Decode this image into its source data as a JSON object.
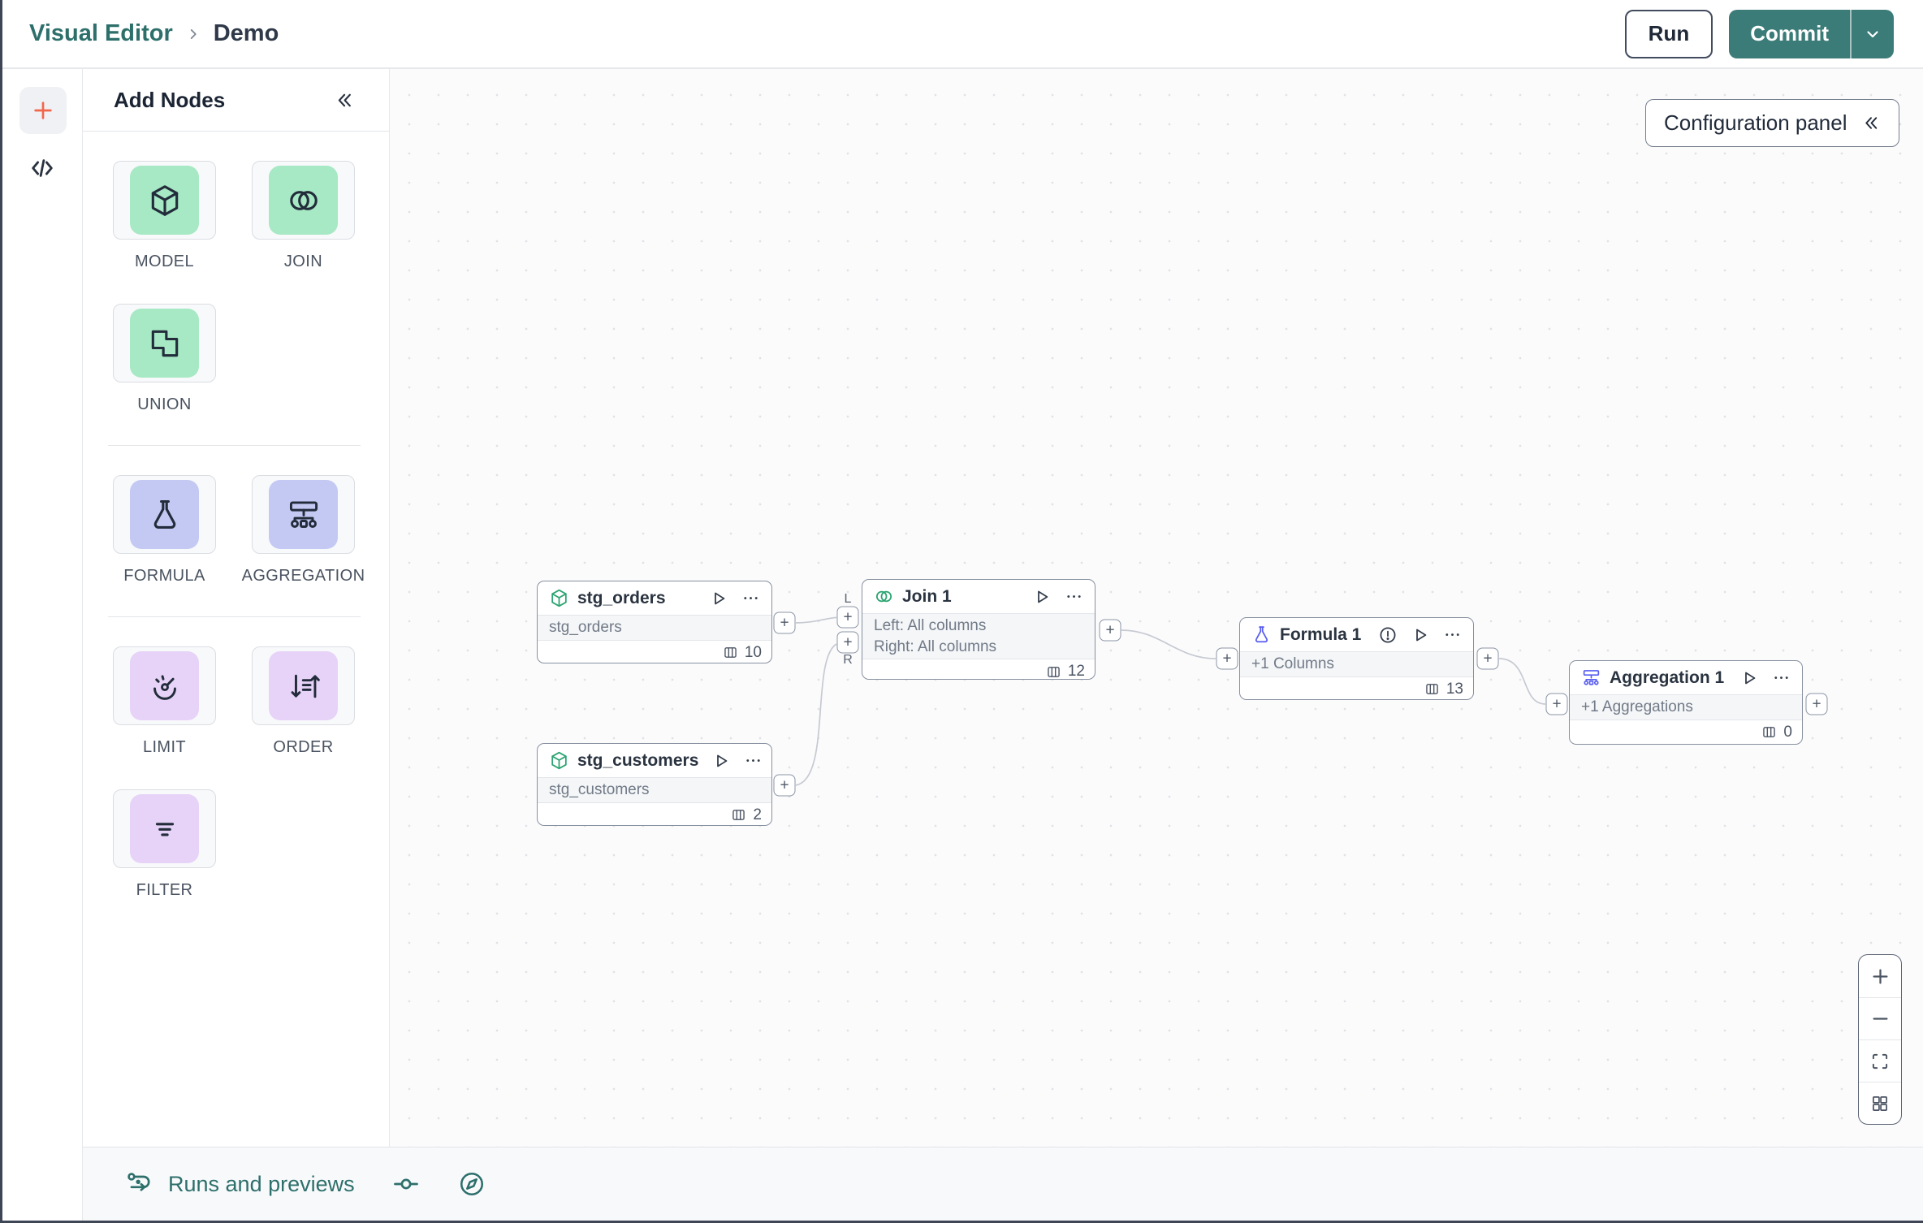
{
  "header": {
    "breadcrumb": {
      "root": "Visual Editor",
      "current": "Demo"
    },
    "run_label": "Run",
    "commit_label": "Commit"
  },
  "add_nodes_panel": {
    "title": "Add Nodes",
    "groups": [
      {
        "items": [
          {
            "label": "MODEL",
            "icon": "cube-icon",
            "tile_color": "#A6E9C4"
          },
          {
            "label": "JOIN",
            "icon": "join-circles-icon",
            "tile_color": "#A6E9C4"
          },
          {
            "label": "UNION",
            "icon": "union-shapes-icon",
            "tile_color": "#A6E9C4"
          }
        ]
      },
      {
        "items": [
          {
            "label": "FORMULA",
            "icon": "flask-icon",
            "tile_color": "#C4C9F4"
          },
          {
            "label": "AGGREGATION",
            "icon": "aggregation-tree-icon",
            "tile_color": "#C4C9F4"
          }
        ]
      },
      {
        "items": [
          {
            "label": "LIMIT",
            "icon": "gauge-icon",
            "tile_color": "#E6D3F7"
          },
          {
            "label": "ORDER",
            "icon": "sort-order-icon",
            "tile_color": "#E6D3F7"
          },
          {
            "label": "FILTER",
            "icon": "filter-lines-icon",
            "tile_color": "#E6D3F7"
          }
        ]
      }
    ]
  },
  "canvas": {
    "config_panel_label": "Configuration panel",
    "nodes": [
      {
        "title": "stg_orders",
        "type": "model",
        "body_lines": [
          "stg_orders"
        ],
        "column_count": "10",
        "has_warning": false
      },
      {
        "title": "Join 1",
        "type": "join",
        "body_lines": [
          "Left: All columns",
          "Right: All columns"
        ],
        "column_count": "12",
        "has_warning": false
      },
      {
        "title": "stg_customers",
        "type": "model",
        "body_lines": [
          "stg_customers"
        ],
        "column_count": "2",
        "has_warning": false
      },
      {
        "title": "Formula 1",
        "type": "formula",
        "body_lines": [
          "+1 Columns"
        ],
        "column_count": "13",
        "has_warning": true
      },
      {
        "title": "Aggregation 1",
        "type": "aggregation",
        "body_lines": [
          "+1 Aggregations"
        ],
        "column_count": "0",
        "has_warning": false
      }
    ],
    "ports": {
      "plus": "+",
      "left": "L",
      "right": "R"
    }
  },
  "bottom_bar": {
    "runs_label": "Runs and previews"
  },
  "colors": {
    "brand_teal": "#2D6F6B",
    "commit_button_teal": "#3C7C78",
    "accent_orange": "#F2664B",
    "tile_green": "#A6E9C4",
    "tile_periwinkle": "#C4C9F4",
    "tile_purple": "#E6D3F7",
    "node_icon_green": "#2BA471",
    "node_icon_indigo": "#585DF2",
    "warning_orange": "#BE5B17"
  }
}
